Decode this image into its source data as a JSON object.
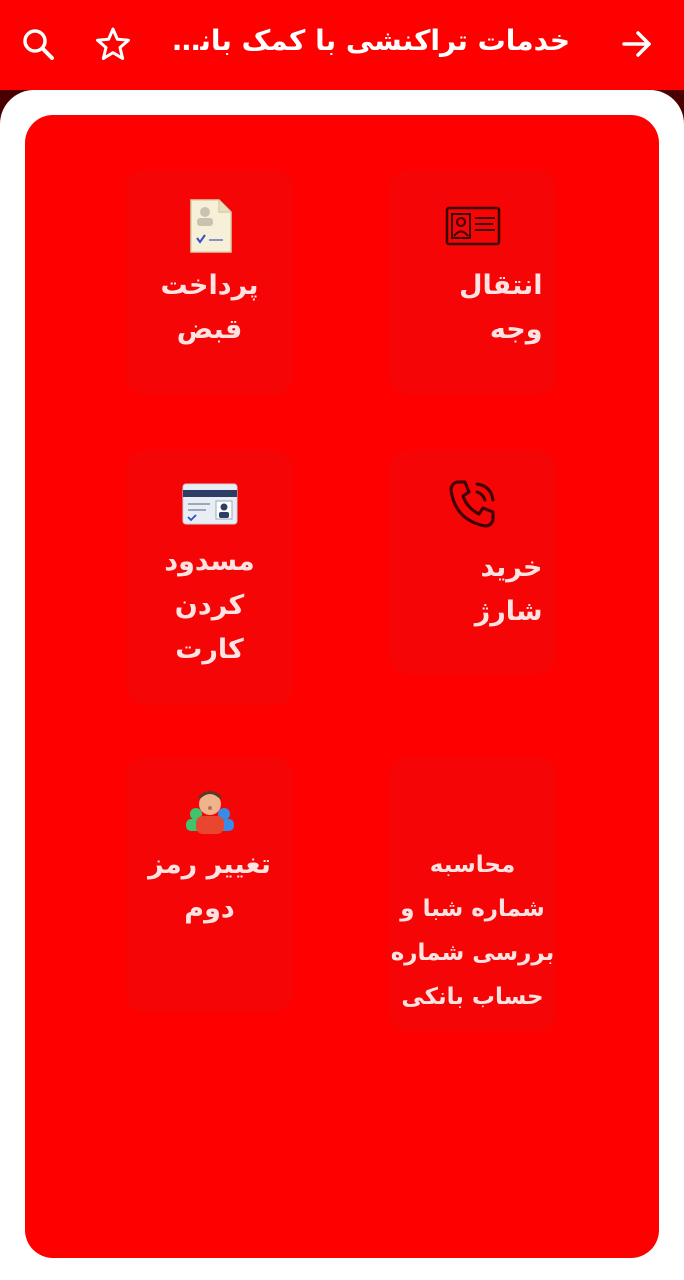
{
  "header": {
    "title": "خدمات تراکنشی با کمک  بانک...",
    "back_icon": "arrow-right-icon",
    "favorite_icon": "star-icon",
    "search_icon": "search-icon"
  },
  "services": [
    {
      "label": "انتقال\nوجه",
      "icon": "id-card-icon"
    },
    {
      "label": "پرداخت\nقبض",
      "icon": "document-icon"
    },
    {
      "label": "خرید\nشارژ",
      "icon": "phone-icon"
    },
    {
      "label": "مسدود\nکردن\nکارت",
      "icon": "bank-card-icon"
    },
    {
      "label": "محاسبه\nشماره شبا و\nبررسی شماره\nحساب بانکی",
      "icon": ""
    },
    {
      "label": "تغییر رمز\nدوم",
      "icon": "user-group-icon"
    }
  ],
  "colors": {
    "accent": "#ff0000",
    "tile": "#f50505",
    "label": "#ffe3e3"
  }
}
